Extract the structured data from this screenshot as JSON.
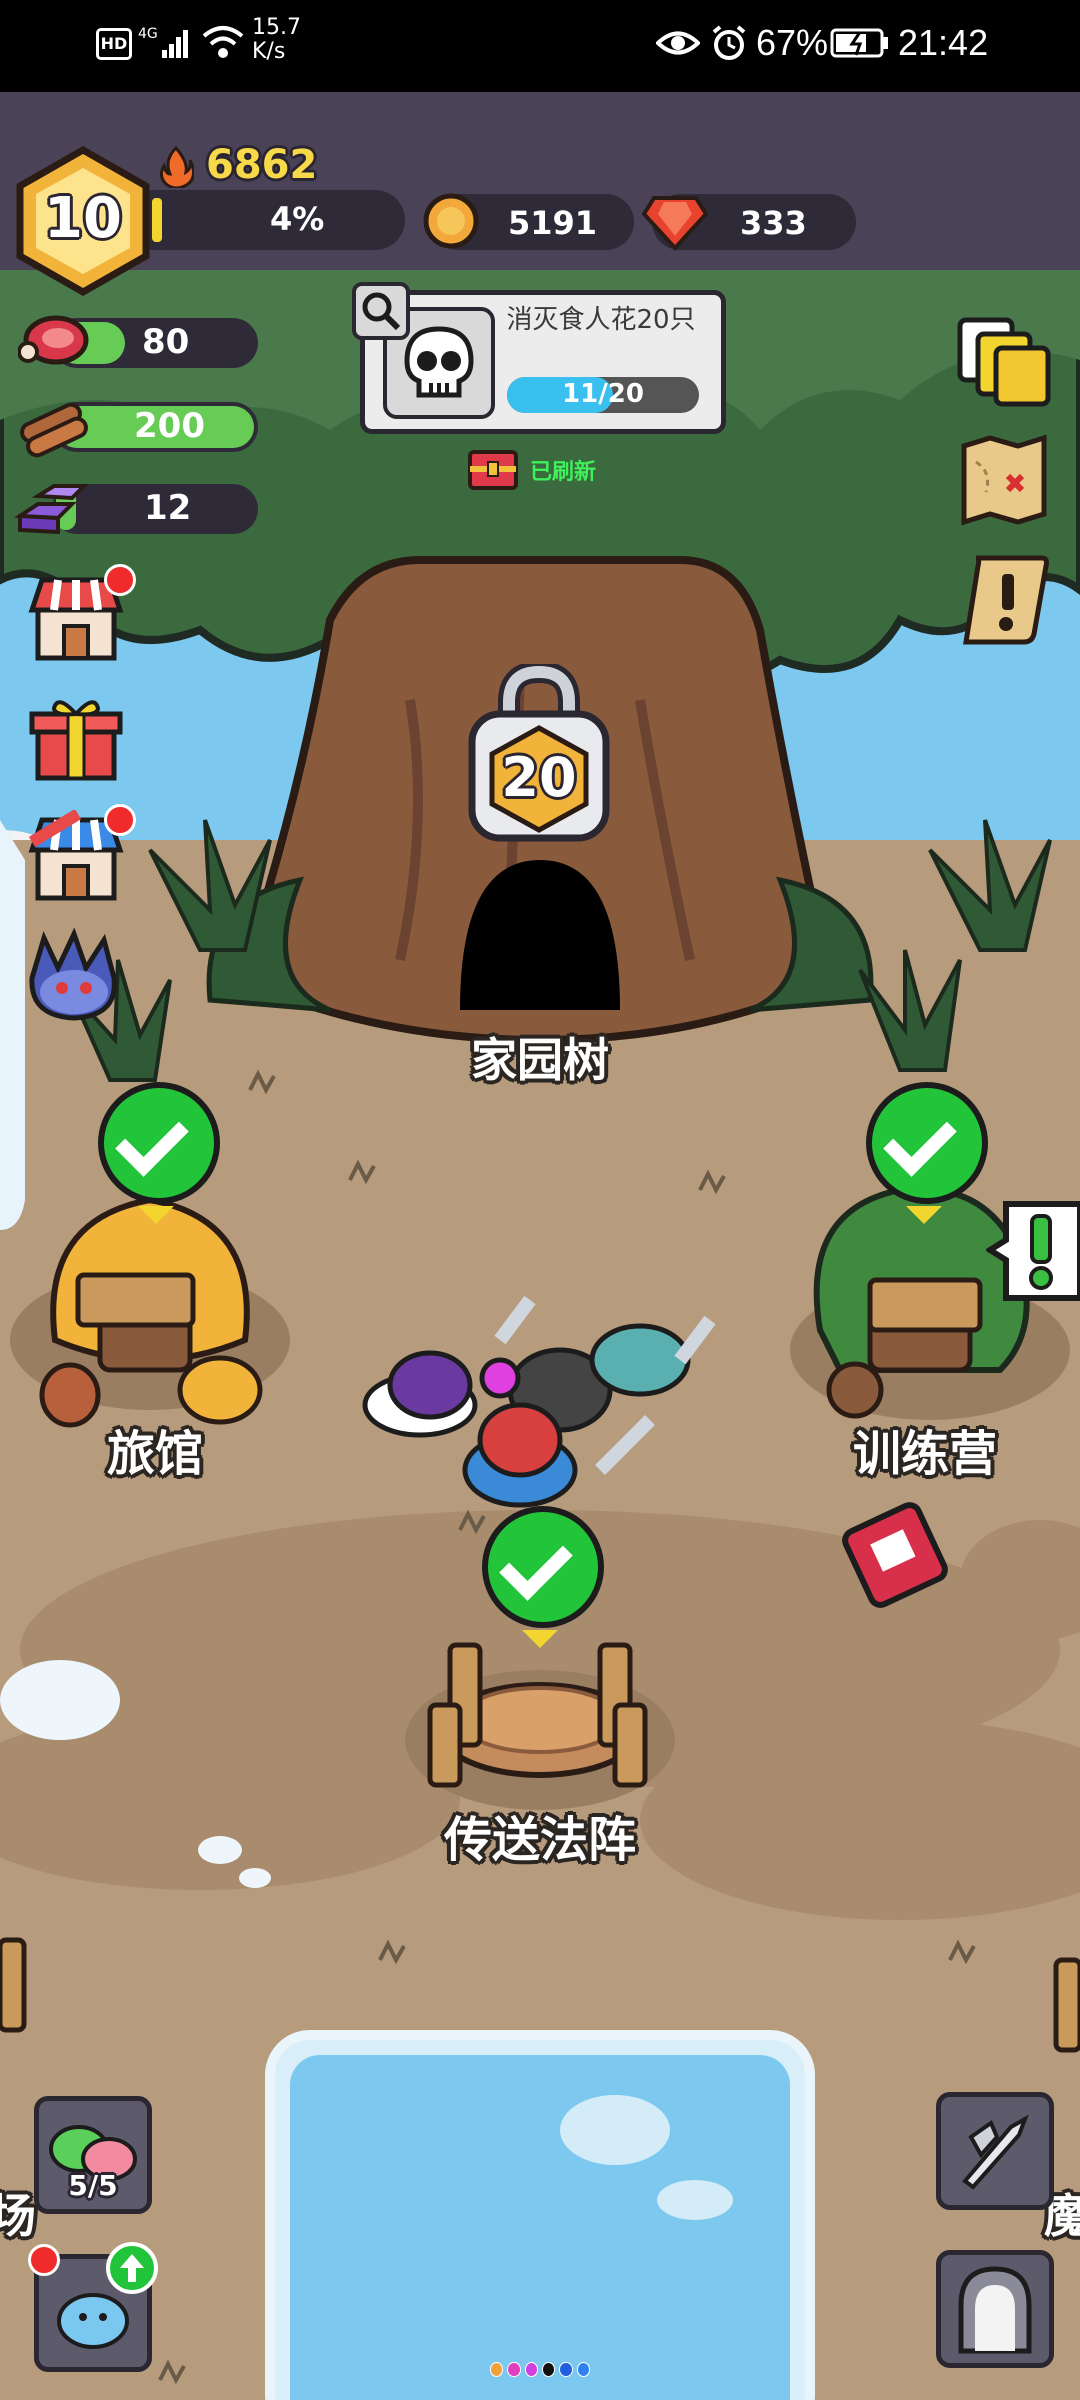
{
  "status_bar": {
    "left_icons": [
      "hd-icon",
      "4g-signal-icon",
      "wifi-icon"
    ],
    "net_speed": "15.7",
    "net_speed_unit": "K/s",
    "battery": "67%",
    "time": "21:42"
  },
  "player": {
    "level": "10",
    "power": "6862",
    "exp_percent_label": "4%",
    "exp_fraction": 0.04,
    "gold": "5191",
    "gems": "333"
  },
  "resources": [
    {
      "name": "meat",
      "value": "80",
      "fill": 0.35
    },
    {
      "name": "wood",
      "value": "200",
      "fill": 1.0
    },
    {
      "name": "ore",
      "value": "12",
      "fill": 0.05
    }
  ],
  "quest": {
    "title": "消灭食人花20只",
    "progress_label": "11/20",
    "progress": 0.55,
    "refresh_label": "已刷新"
  },
  "tree": {
    "lock_level": "20",
    "name": "家园树"
  },
  "buildings": {
    "inn": "旅馆",
    "training": "训练营",
    "portal": "传送法阵",
    "left_edge": "场",
    "right_edge": "魔"
  },
  "slime_counter": "5/5",
  "page_dots": [
    "#f2a03a",
    "#e040c0",
    "#d040e0",
    "#111111",
    "#2060e0",
    "#3080f0"
  ],
  "colors": {
    "hud_bg": "#4a4358",
    "grass": "#3a6a3e",
    "ground": "#b79b7d",
    "water": "#7cc8ef",
    "check": "#22c53a"
  }
}
